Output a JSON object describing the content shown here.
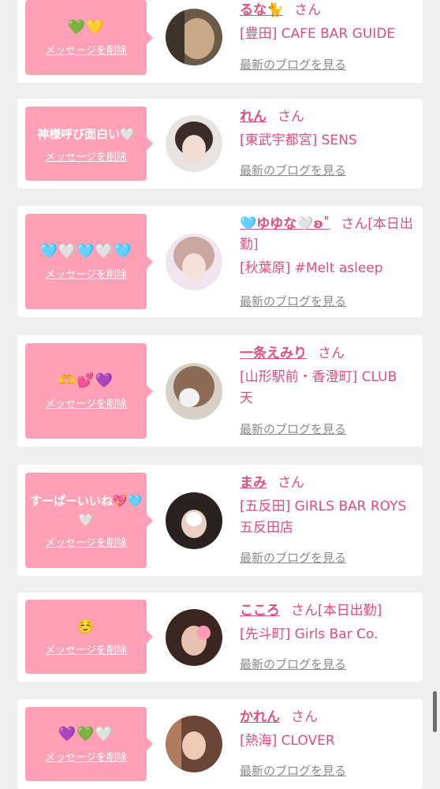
{
  "common": {
    "delete_label": "メッセージを削除",
    "blog_label": "最新のブログを見る"
  },
  "colors": {
    "bubble": "#fea1b5",
    "name_text": "#dc4f7e",
    "blog_link": "#8a8a8a"
  },
  "cards": [
    {
      "message": "💚💛",
      "name": "るな🐈",
      "suffix": "さん",
      "shop": "[豊田] CAFE BAR GUIDE"
    },
    {
      "message": "神様呼び面白い🤍",
      "name": "れん",
      "suffix": "さん",
      "shop": "[東武宇都宮] SENS"
    },
    {
      "message": "🩵🤍🩵🤍🩵",
      "name": "🩵ゆゆな🤍ʚ˚",
      "suffix": "さん[本日出勤]",
      "shop": "[秋葉原] #Melt asleep"
    },
    {
      "message": "🫶💕💜",
      "name": "一条えみり",
      "suffix": "さん",
      "shop": "[山形駅前・香澄町] CLUB 天"
    },
    {
      "message": "すーぱーいいね💖🩵🤍",
      "name": "まみ",
      "suffix": "さん",
      "shop": "[五反田] GIRLS BAR ROYS五反田店"
    },
    {
      "message": "☺️",
      "name": "こころ",
      "suffix": "さん[本日出勤]",
      "shop": "[先斗町] Girls Bar Co."
    },
    {
      "message": "💜💚🤍",
      "name": "かれん",
      "suffix": "さん",
      "shop": "[熱海] CLOVER"
    }
  ]
}
